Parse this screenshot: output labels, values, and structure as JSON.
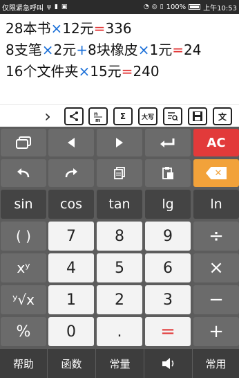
{
  "statusbar": {
    "carrier": "仅限紧急呼叫",
    "battery": "100%",
    "time": "上午10:53"
  },
  "display": {
    "line1": {
      "a": "28本书",
      "op1": "×",
      "b": "12元",
      "eq": "=",
      "result": "336"
    },
    "line2": {
      "a": "8支笔",
      "op1": "×",
      "b": "2元",
      "op2": "+",
      "c": "8块橡皮",
      "op3": "×",
      "d": "1元",
      "eq": "=",
      "result": "24"
    },
    "line3": {
      "a": "16个文件夹",
      "op1": "×",
      "b": "15元",
      "eq": "=",
      "result": "240"
    }
  },
  "toolbar": {
    "chevron": "›",
    "share": "<",
    "sigma": "Σ",
    "capital": "大写",
    "text": "文"
  },
  "keys": {
    "ac": "AC",
    "sin": "sin",
    "cos": "cos",
    "tan": "tan",
    "lg": "lg",
    "ln": "ln",
    "parens": "( )",
    "power": "xʸ",
    "root": "ʸ√x",
    "percent": "%",
    "n0": "0",
    "n1": "1",
    "n2": "2",
    "n3": "3",
    "n4": "4",
    "n5": "5",
    "n6": "6",
    "n7": "7",
    "n8": "8",
    "n9": "9",
    "dot": ".",
    "equals": "=",
    "divide": "÷",
    "multiply": "×",
    "minus": "−",
    "plus": "+"
  },
  "bottom": {
    "help": "帮助",
    "functions": "函数",
    "constants": "常量",
    "common": "常用"
  },
  "colors": {
    "accent_red": "#e23a3a",
    "accent_orange": "#f2a23a",
    "operator_blue": "#1a6fd8"
  }
}
